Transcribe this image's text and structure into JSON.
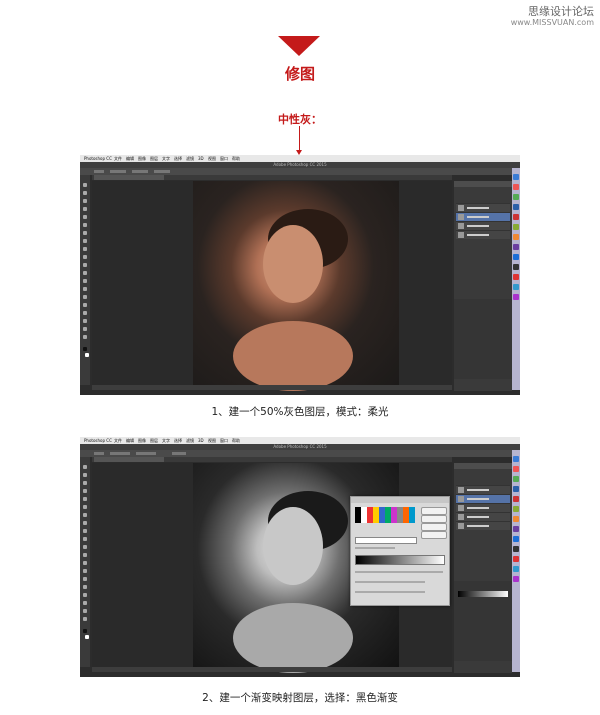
{
  "watermark": {
    "site_name": "思缘设计论坛",
    "site_url": "www.MISSVUAN.com"
  },
  "section": {
    "title": "修图",
    "subtitle": "中性灰："
  },
  "steps": [
    {
      "caption": "1、建一个50%灰色图层，模式：柔光",
      "window_title": "Adobe Photoshop CC 2015",
      "menu": [
        "Photoshop CC",
        "文件",
        "编辑",
        "图像",
        "图层",
        "文字",
        "选择",
        "滤镜",
        "3D",
        "视图",
        "窗口",
        "帮助"
      ],
      "photo_style": "color"
    },
    {
      "caption": "2、建一个渐变映射图层，选择：黑色渐变",
      "window_title": "Adobe Photoshop CC 2015",
      "menu": [
        "Photoshop CC",
        "文件",
        "编辑",
        "图像",
        "图层",
        "文字",
        "选择",
        "滤镜",
        "3D",
        "视图",
        "窗口",
        "帮助"
      ],
      "photo_style": "bw"
    }
  ],
  "colors": {
    "accent": "#c41a1a",
    "ps_dark": "#2c2c2c",
    "layer_selected": "#5573a8"
  }
}
